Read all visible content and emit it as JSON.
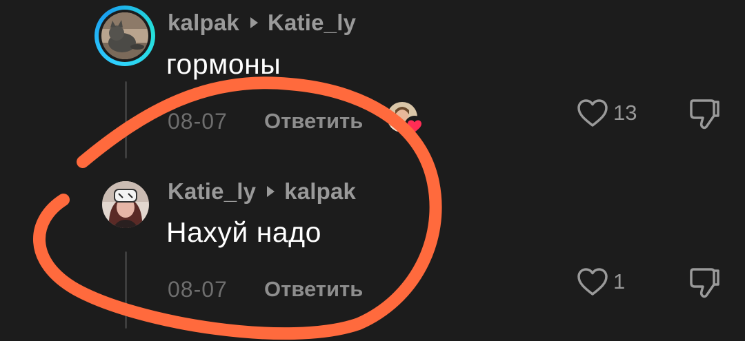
{
  "comments": [
    {
      "author": "kalpak",
      "reply_to": "Katie_ly",
      "text": "гормоны",
      "date": "08-07",
      "reply_label": "Ответить",
      "likes": "13",
      "avatar_icon": "cat-avatar",
      "story_ring": true,
      "author_liked": true
    },
    {
      "author": "Katie_ly",
      "reply_to": "kalpak",
      "text": "Нахуй надо",
      "date": "08-07",
      "reply_label": "Ответить",
      "likes": "1",
      "avatar_icon": "girl-avatar",
      "story_ring": false,
      "author_liked": false
    }
  ],
  "icons": {
    "like": "heart-outline-icon",
    "dislike": "thumbs-down-icon",
    "separator": "caret-right-icon"
  },
  "colors": {
    "background": "#1c1c1c",
    "username": "#9a9a9a",
    "body": "#ffffff",
    "meta": "#6e6e6e",
    "story_ring": "#2fd1ff",
    "heart_badge": "#ff2d55",
    "annotation": "#ff6a3d"
  }
}
